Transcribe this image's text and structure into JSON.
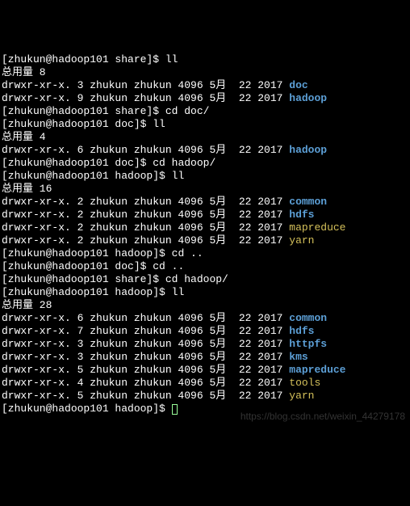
{
  "prompts": {
    "share": "[zhukun@hadoop101 share]$ ",
    "doc": "[zhukun@hadoop101 doc]$ ",
    "hadoop": "[zhukun@hadoop101 hadoop]$ "
  },
  "cmds": {
    "ll": "ll",
    "cd_doc": "cd doc/",
    "cd_hadoop": "cd hadoop/",
    "cd_up": "cd .."
  },
  "totals": {
    "t8": "总用量 8",
    "t4": "总用量 4",
    "t16": "总用量 16",
    "t28": "总用量 28"
  },
  "ls1": [
    {
      "perm": "drwxr-xr-x.",
      "n": "3",
      "u": "zhukun",
      "g": "zhukun",
      "sz": "4096",
      "mon": "5月",
      "d": "22",
      "y": "2017",
      "name": "doc"
    },
    {
      "perm": "drwxr-xr-x.",
      "n": "9",
      "u": "zhukun",
      "g": "zhukun",
      "sz": "4096",
      "mon": "5月",
      "d": "22",
      "y": "2017",
      "name": "hadoop"
    }
  ],
  "ls2": [
    {
      "perm": "drwxr-xr-x.",
      "n": "6",
      "u": "zhukun",
      "g": "zhukun",
      "sz": "4096",
      "mon": "5月",
      "d": "22",
      "y": "2017",
      "name": "hadoop"
    }
  ],
  "ls3": [
    {
      "perm": "drwxr-xr-x.",
      "n": "2",
      "u": "zhukun",
      "g": "zhukun",
      "sz": "4096",
      "mon": "5月",
      "d": "22",
      "y": "2017",
      "name": "common"
    },
    {
      "perm": "drwxr-xr-x.",
      "n": "2",
      "u": "zhukun",
      "g": "zhukun",
      "sz": "4096",
      "mon": "5月",
      "d": "22",
      "y": "2017",
      "name": "hdfs"
    },
    {
      "perm": "drwxr-xr-x.",
      "n": "2",
      "u": "zhukun",
      "g": "zhukun",
      "sz": "4096",
      "mon": "5月",
      "d": "22",
      "y": "2017",
      "name": "mapreduce",
      "yellow": true
    },
    {
      "perm": "drwxr-xr-x.",
      "n": "2",
      "u": "zhukun",
      "g": "zhukun",
      "sz": "4096",
      "mon": "5月",
      "d": "22",
      "y": "2017",
      "name": "yarn",
      "yellow": true
    }
  ],
  "ls4": [
    {
      "perm": "drwxr-xr-x.",
      "n": "6",
      "u": "zhukun",
      "g": "zhukun",
      "sz": "4096",
      "mon": "5月",
      "d": "22",
      "y": "2017",
      "name": "common"
    },
    {
      "perm": "drwxr-xr-x.",
      "n": "7",
      "u": "zhukun",
      "g": "zhukun",
      "sz": "4096",
      "mon": "5月",
      "d": "22",
      "y": "2017",
      "name": "hdfs"
    },
    {
      "perm": "drwxr-xr-x.",
      "n": "3",
      "u": "zhukun",
      "g": "zhukun",
      "sz": "4096",
      "mon": "5月",
      "d": "22",
      "y": "2017",
      "name": "httpfs"
    },
    {
      "perm": "drwxr-xr-x.",
      "n": "3",
      "u": "zhukun",
      "g": "zhukun",
      "sz": "4096",
      "mon": "5月",
      "d": "22",
      "y": "2017",
      "name": "kms"
    },
    {
      "perm": "drwxr-xr-x.",
      "n": "5",
      "u": "zhukun",
      "g": "zhukun",
      "sz": "4096",
      "mon": "5月",
      "d": "22",
      "y": "2017",
      "name": "mapreduce"
    },
    {
      "perm": "drwxr-xr-x.",
      "n": "4",
      "u": "zhukun",
      "g": "zhukun",
      "sz": "4096",
      "mon": "5月",
      "d": "22",
      "y": "2017",
      "name": "tools",
      "yellow": true
    },
    {
      "perm": "drwxr-xr-x.",
      "n": "5",
      "u": "zhukun",
      "g": "zhukun",
      "sz": "4096",
      "mon": "5月",
      "d": "22",
      "y": "2017",
      "name": "yarn",
      "yellow": true
    }
  ],
  "watermark": "https://blog.csdn.net/weixin_44279178"
}
